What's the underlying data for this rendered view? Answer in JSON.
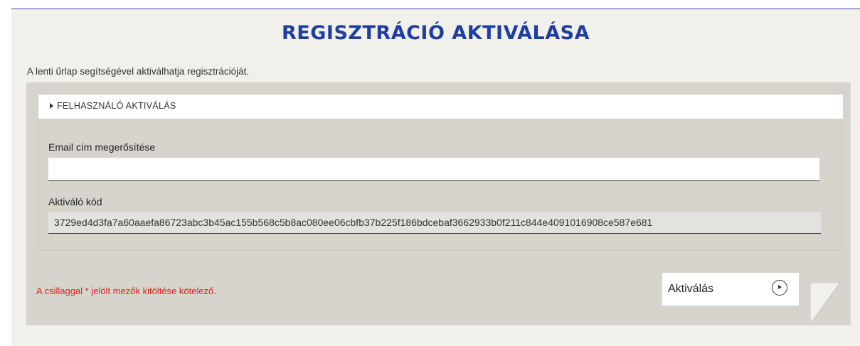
{
  "page": {
    "title": "REGISZTRÁCIÓ AKTIVÁLÁSA",
    "intro": "A lenti űrlap segítségével aktiválhatja regisztrációját."
  },
  "form": {
    "section_label": "FELHASZNÁLÓ AKTIVÁLÁS",
    "email_label": "Email cím megerősítése",
    "email_value": "",
    "code_label": "Aktiváló kód",
    "code_value": "3729ed4d3fa7a60aaefa86723abc3b45ac155b568c5b8ac080ee06cbfb37b225f186bdcebaf3662933b0f211c844e4091016908ce587e681",
    "required_note": "A csillaggal * jelölt mezők kitöltése kötelező.",
    "submit_label": "Aktiválás"
  },
  "icons": {
    "section": "triangle-right-icon",
    "submit": "play-circle-icon"
  },
  "colors": {
    "title": "#1e3ea3",
    "required": "#e02020",
    "form_bg": "#d6d4cc",
    "page_bg": "#f2f0eb"
  }
}
